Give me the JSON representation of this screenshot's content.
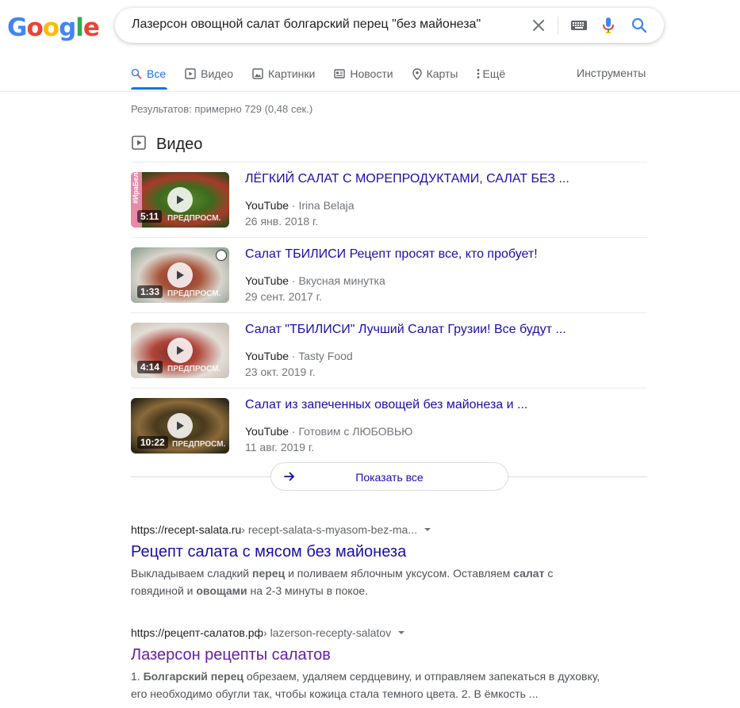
{
  "logo": {
    "letters": [
      "G",
      "o",
      "o",
      "g",
      "l",
      "e"
    ],
    "colors": [
      "#4285F4",
      "#EA4335",
      "#FBBC05",
      "#4285F4",
      "#34A853",
      "#EA4335"
    ]
  },
  "search": {
    "query": "Лазерсон овощной салат болгарский перец \"без майонеза\""
  },
  "tabs": [
    {
      "label": "Все",
      "icon": "search-icon"
    },
    {
      "label": "Видео",
      "icon": "video-icon"
    },
    {
      "label": "Картинки",
      "icon": "image-icon"
    },
    {
      "label": "Новости",
      "icon": "news-icon"
    },
    {
      "label": "Карты",
      "icon": "map-pin-icon"
    },
    {
      "label": "Ещё",
      "icon": "more-vert-icon"
    }
  ],
  "tools_label": "Инструменты",
  "stats": "Результатов: примерно 729 (0,48 сек.)",
  "videos": {
    "heading": "Видео",
    "items": [
      {
        "title": "ЛЁГКИЙ САЛАТ С МОРЕПРОДУКТАМИ, САЛАТ БЕЗ ...",
        "source": "YouTube",
        "channel": "Irina Belaja",
        "date": "26 янв. 2018 г.",
        "duration": "5:11",
        "preview": "ПРЕДПРОСМ."
      },
      {
        "title": "Салат ТБИЛИСИ Рецепт просят все, кто пробует!",
        "source": "YouTube",
        "channel": "Вкусная минутка",
        "date": "29 сент. 2017 г.",
        "duration": "1:33",
        "preview": "ПРЕДПРОСМ."
      },
      {
        "title": "Салат \"ТБИЛИСИ\" Лучший Салат Грузии! Все будут ...",
        "source": "YouTube",
        "channel": "Tasty Food",
        "date": "23 окт. 2019 г.",
        "duration": "4:14",
        "preview": "ПРЕДПРОСМ."
      },
      {
        "title": "Салат из запеченных овощей без майонеза и ...",
        "source": "YouTube",
        "channel": "Готовим с ЛЮБОВЬЮ",
        "date": "11 авг. 2019 г.",
        "duration": "10:22",
        "preview": "ПРЕДПРОСМ."
      }
    ],
    "show_all": "Показать все",
    "thumb_label_1": "#ИраБелая"
  },
  "results": [
    {
      "url_host": "https://recept-salata.ru",
      "url_path": " › recept-salata-s-myasom-bez-ma...",
      "title": "Рецепт салата с мясом без майонеза",
      "snippet_line1": [
        "Выкладываем сладкий ",
        "перец",
        " и поливаем яблочным уксусом. Оставляем ",
        "салат",
        " с"
      ],
      "snippet_line2": [
        "говядиной и ",
        "овощами",
        " на 2-3 минуты в покое."
      ]
    },
    {
      "url_host": "https://рецепт-салатов.рф",
      "url_path": " › lazerson-recepty-salatov",
      "title": "Лазерсон рецепты салатов",
      "snippet_line1": [
        "1. ",
        "Болгарский перец",
        " обрезаем, удаляем сердцевину, и отправляем запекаться в духовку,"
      ],
      "snippet_line2": [
        "его необходимо обугли так, чтобы кожица стала темного цвета. 2. В ёмкость ..."
      ]
    }
  ]
}
